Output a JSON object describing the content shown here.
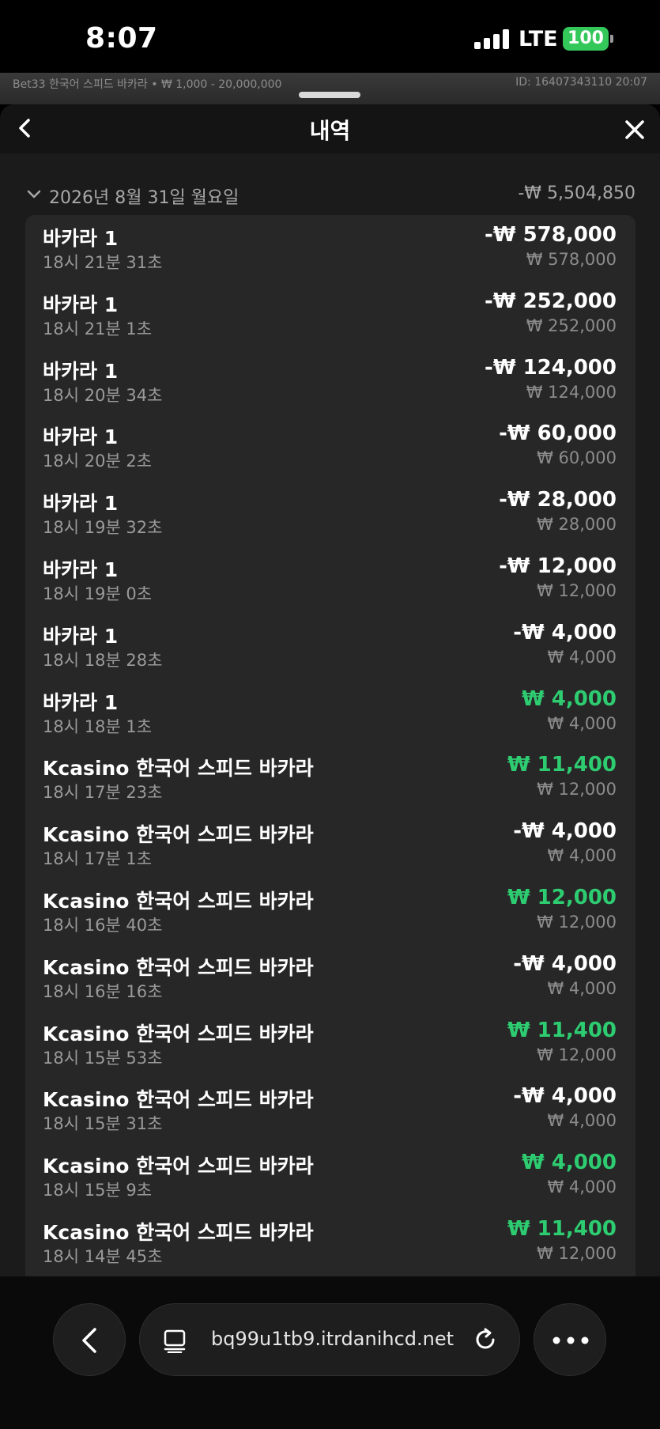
{
  "status_bar": {
    "time": "8:07",
    "network": "LTE",
    "battery": "100"
  },
  "game_strip": {
    "table_info": "Bet33 한국어 스피드 바카라 • ₩ 1,000 - 20,000,000",
    "round_id": "ID: 16407343110 20:07"
  },
  "header": {
    "title": "내역"
  },
  "day": {
    "date": "2026년 8월 31일 월요일",
    "total": "-₩ 5,504,850"
  },
  "transactions": [
    {
      "game": "바카라 1",
      "time": "18시 21분 31초",
      "amount": "-₩ 578,000",
      "stake": "₩ 578,000",
      "win": false
    },
    {
      "game": "바카라 1",
      "time": "18시 21분 1초",
      "amount": "-₩ 252,000",
      "stake": "₩ 252,000",
      "win": false
    },
    {
      "game": "바카라 1",
      "time": "18시 20분 34초",
      "amount": "-₩ 124,000",
      "stake": "₩ 124,000",
      "win": false
    },
    {
      "game": "바카라 1",
      "time": "18시 20분 2초",
      "amount": "-₩ 60,000",
      "stake": "₩ 60,000",
      "win": false
    },
    {
      "game": "바카라 1",
      "time": "18시 19분 32초",
      "amount": "-₩ 28,000",
      "stake": "₩ 28,000",
      "win": false
    },
    {
      "game": "바카라 1",
      "time": "18시 19분 0초",
      "amount": "-₩ 12,000",
      "stake": "₩ 12,000",
      "win": false
    },
    {
      "game": "바카라 1",
      "time": "18시 18분 28초",
      "amount": "-₩ 4,000",
      "stake": "₩ 4,000",
      "win": false
    },
    {
      "game": "바카라 1",
      "time": "18시 18분 1초",
      "amount": "₩ 4,000",
      "stake": "₩ 4,000",
      "win": true
    },
    {
      "game": "Kcasino 한국어 스피드 바카라",
      "time": "18시 17분 23초",
      "amount": "₩ 11,400",
      "stake": "₩ 12,000",
      "win": true
    },
    {
      "game": "Kcasino 한국어 스피드 바카라",
      "time": "18시 17분 1초",
      "amount": "-₩ 4,000",
      "stake": "₩ 4,000",
      "win": false
    },
    {
      "game": "Kcasino 한국어 스피드 바카라",
      "time": "18시 16분 40초",
      "amount": "₩ 12,000",
      "stake": "₩ 12,000",
      "win": true
    },
    {
      "game": "Kcasino 한국어 스피드 바카라",
      "time": "18시 16분 16초",
      "amount": "-₩ 4,000",
      "stake": "₩ 4,000",
      "win": false
    },
    {
      "game": "Kcasino 한국어 스피드 바카라",
      "time": "18시 15분 53초",
      "amount": "₩ 11,400",
      "stake": "₩ 12,000",
      "win": true
    },
    {
      "game": "Kcasino 한국어 스피드 바카라",
      "time": "18시 15분 31초",
      "amount": "-₩ 4,000",
      "stake": "₩ 4,000",
      "win": false
    },
    {
      "game": "Kcasino 한국어 스피드 바카라",
      "time": "18시 15분 9초",
      "amount": "₩ 4,000",
      "stake": "₩ 4,000",
      "win": true
    },
    {
      "game": "Kcasino 한국어 스피드 바카라",
      "time": "18시 14분 45초",
      "amount": "₩ 11,400",
      "stake": "₩ 12,000",
      "win": true
    }
  ],
  "browser": {
    "url": "bq99u1tb9.itrdanihcd.net"
  },
  "colors": {
    "win": "#2ecc71",
    "battery": "#34c759",
    "card_bg": "#272727"
  }
}
